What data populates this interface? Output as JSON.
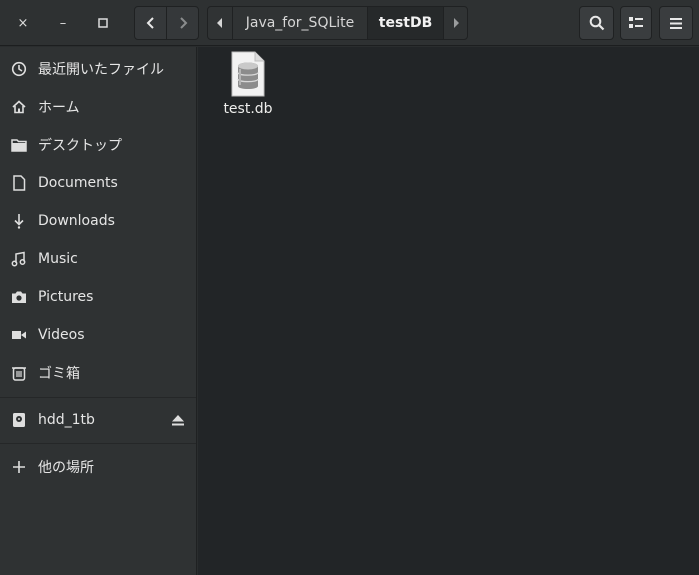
{
  "window": {
    "close_glyph": "×",
    "minimize_glyph": "–",
    "maximize_glyph": "□"
  },
  "path": {
    "crumbs": [
      "Java_for_SQLite",
      "testDB"
    ],
    "active_index": 1
  },
  "sidebar": {
    "items": [
      {
        "label": "最近開いたファイル",
        "icon": "recent-clock-icon"
      },
      {
        "label": "ホーム",
        "icon": "home-icon"
      },
      {
        "label": "デスクトップ",
        "icon": "folder-icon"
      },
      {
        "label": "Documents",
        "icon": "document-icon"
      },
      {
        "label": "Downloads",
        "icon": "download-icon"
      },
      {
        "label": "Music",
        "icon": "music-icon"
      },
      {
        "label": "Pictures",
        "icon": "camera-icon"
      },
      {
        "label": "Videos",
        "icon": "video-icon"
      },
      {
        "label": "ゴミ箱",
        "icon": "trash-icon"
      }
    ],
    "devices": [
      {
        "label": "hdd_1tb",
        "icon": "drive-icon"
      }
    ],
    "other_locations": {
      "label": "他の場所",
      "icon": "plus-icon"
    }
  },
  "files": [
    {
      "name": "test.db",
      "icon": "database-file-icon"
    }
  ],
  "colors": {
    "background": "#222527",
    "sidebar": "#2f3233",
    "header": "#2e3132",
    "text": "#eeeeec"
  }
}
